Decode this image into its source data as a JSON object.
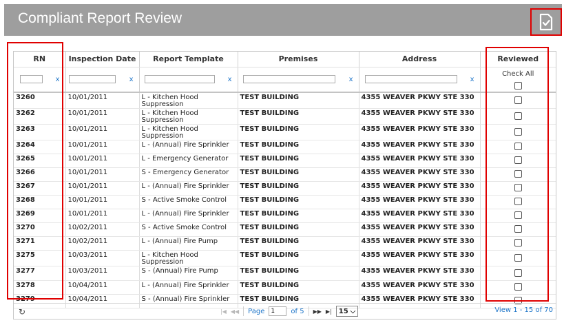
{
  "header": {
    "title": "Compliant Report Review",
    "action_icon": "document-check-icon"
  },
  "columns": [
    "RN",
    "Inspection Date",
    "Report Template",
    "Premises",
    "Address",
    "Reviewed"
  ],
  "filters": {
    "clear_label": "x",
    "check_all_label": "Check All"
  },
  "rows": [
    {
      "rn": "3260",
      "date": "10/01/2011",
      "template": "L - Kitchen Hood Suppression",
      "premises": "TEST BUILDING",
      "address": "4355 WEAVER PKWY STE 330",
      "reviewed": false
    },
    {
      "rn": "3262",
      "date": "10/01/2011",
      "template": "L - Kitchen Hood Suppression",
      "premises": "TEST BUILDING",
      "address": "4355 WEAVER PKWY STE 330",
      "reviewed": false
    },
    {
      "rn": "3263",
      "date": "10/01/2011",
      "template": "L - Kitchen Hood Suppression",
      "premises": "TEST BUILDING",
      "address": "4355 WEAVER PKWY STE 330",
      "reviewed": false
    },
    {
      "rn": "3264",
      "date": "10/01/2011",
      "template": "L - (Annual) Fire Sprinkler",
      "premises": "TEST BUILDING",
      "address": "4355 WEAVER PKWY STE 330",
      "reviewed": false
    },
    {
      "rn": "3265",
      "date": "10/01/2011",
      "template": "L - Emergency Generator",
      "premises": "TEST BUILDING",
      "address": "4355 WEAVER PKWY STE 330",
      "reviewed": false
    },
    {
      "rn": "3266",
      "date": "10/01/2011",
      "template": "S - Emergency Generator",
      "premises": "TEST BUILDING",
      "address": "4355 WEAVER PKWY STE 330",
      "reviewed": false
    },
    {
      "rn": "3267",
      "date": "10/01/2011",
      "template": "L - (Annual) Fire Sprinkler",
      "premises": "TEST BUILDING",
      "address": "4355 WEAVER PKWY STE 330",
      "reviewed": false
    },
    {
      "rn": "3268",
      "date": "10/01/2011",
      "template": "S - Active Smoke Control",
      "premises": "TEST BUILDING",
      "address": "4355 WEAVER PKWY STE 330",
      "reviewed": false
    },
    {
      "rn": "3269",
      "date": "10/01/2011",
      "template": "L - (Annual) Fire Sprinkler",
      "premises": "TEST BUILDING",
      "address": "4355 WEAVER PKWY STE 330",
      "reviewed": false
    },
    {
      "rn": "3270",
      "date": "10/02/2011",
      "template": "S - Active Smoke Control",
      "premises": "TEST BUILDING",
      "address": "4355 WEAVER PKWY STE 330",
      "reviewed": false
    },
    {
      "rn": "3271",
      "date": "10/02/2011",
      "template": "L - (Annual) Fire Pump",
      "premises": "TEST BUILDING",
      "address": "4355 WEAVER PKWY STE 330",
      "reviewed": false
    },
    {
      "rn": "3275",
      "date": "10/03/2011",
      "template": "L - Kitchen Hood Suppression",
      "premises": "TEST BUILDING",
      "address": "4355 WEAVER PKWY STE 330",
      "reviewed": false
    },
    {
      "rn": "3277",
      "date": "10/03/2011",
      "template": "S - (Annual) Fire Pump",
      "premises": "TEST BUILDING",
      "address": "4355 WEAVER PKWY STE 330",
      "reviewed": false
    },
    {
      "rn": "3278",
      "date": "10/04/2011",
      "template": "L - (Annual) Fire Sprinkler",
      "premises": "TEST BUILDING",
      "address": "4355 WEAVER PKWY STE 330",
      "reviewed": false
    },
    {
      "rn": "3279",
      "date": "10/04/2011",
      "template": "S - (Annual) Fire Sprinkler",
      "premises": "TEST BUILDING",
      "address": "4355 WEAVER PKWY STE 330",
      "reviewed": false
    }
  ],
  "pager": {
    "page_label": "Page",
    "current_page": "1",
    "of_label": "of 5",
    "rows_per_page": "15",
    "view_info": "View 1 - 15 of 70",
    "first_icon": "first-page-icon",
    "prev_icon": "prev-page-icon",
    "next_icon": "next-page-icon",
    "last_icon": "last-page-icon",
    "refresh_icon": "refresh-icon"
  },
  "colors": {
    "header_bg": "#9e9e9e",
    "highlight": "#e00000",
    "link": "#1a73c8"
  }
}
